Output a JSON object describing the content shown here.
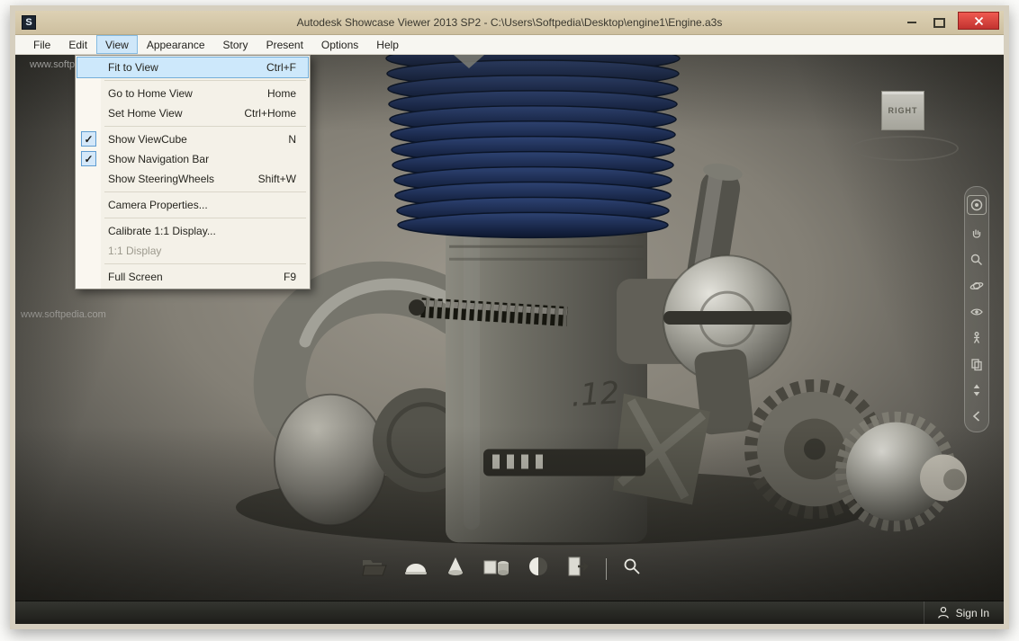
{
  "window": {
    "title": "Autodesk Showcase Viewer 2013 SP2  -  C:\\Users\\Softpedia\\Desktop\\engine1\\Engine.a3s",
    "app_initial": "S"
  },
  "menubar": {
    "items": [
      "File",
      "Edit",
      "View",
      "Appearance",
      "Story",
      "Present",
      "Options",
      "Help"
    ]
  },
  "view_menu": {
    "check_glyph": "✓",
    "items": [
      {
        "label": "Fit to View",
        "shortcut": "Ctrl+F",
        "highlighted": true
      },
      {
        "label": "Go to Home View",
        "shortcut": "Home"
      },
      {
        "label": "Set Home View",
        "shortcut": "Ctrl+Home"
      },
      {
        "label": "Show ViewCube",
        "shortcut": "N",
        "checked": true
      },
      {
        "label": "Show Navigation Bar",
        "checked": true
      },
      {
        "label": "Show SteeringWheels",
        "shortcut": "Shift+W"
      },
      {
        "label": "Camera Properties..."
      },
      {
        "label": "Calibrate 1:1 Display..."
      },
      {
        "label": "1:1 Display",
        "disabled": true
      },
      {
        "label": "Full Screen",
        "shortcut": "F9"
      }
    ]
  },
  "viewport": {
    "viewcube_face": "RIGHT",
    "watermark": "www.softpedia.com",
    "engine_label": ".12"
  },
  "statusbar": {
    "sign_in": "Sign In"
  },
  "colors": {
    "menu_highlight": "#cde8fb",
    "close_red": "#c23330",
    "fin_blue": "#1b2a4d",
    "titlebar_tan": "#d3c6a7"
  }
}
